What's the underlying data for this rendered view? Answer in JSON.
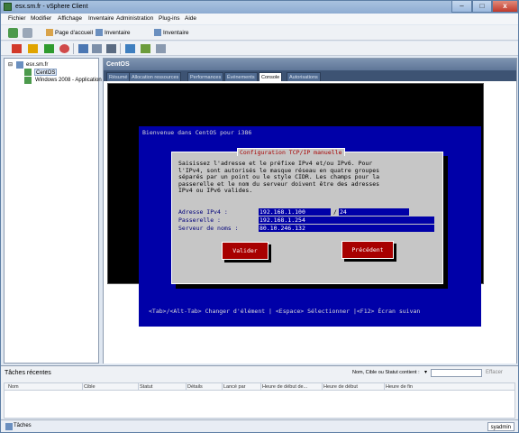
{
  "window": {
    "title": "esx.sm.fr - vSphere Client",
    "controls": [
      "–",
      "□",
      "x"
    ]
  },
  "menu": [
    "Fichier",
    "Modifier",
    "Affichage",
    "Inventaire",
    "Administration",
    "Plug-ins",
    "Aide"
  ],
  "breadcrumb": {
    "home": "Page d'accueil",
    "inventory1": "Inventaire",
    "inventory2": "Inventaire"
  },
  "tree": {
    "host": "esx.sm.fr",
    "vm1": "CentOS",
    "vm2": "Windows 2008 - Application"
  },
  "vm_panel": {
    "title": "CentOS",
    "tabs": [
      "Résumé",
      "Allocation ressources",
      "Performances",
      "Événements",
      "Console",
      "Autorisations"
    ],
    "active_tab": "Console"
  },
  "console": {
    "welcome": "Bienvenue dans CentOS pour i386",
    "dialog_title": "Configuration TCP/IP manuelle",
    "dialog_text": "Saisissez l'adresse et le préfixe IPv4 et/ou IPv6. Pour\nl'IPv4, sont autorisés le masque réseau en quatre groupes\nséparés par un point ou le style CIDR. Les champs pour la\npasserelle et le nom du serveur doivent être des adresses\nIPv4 ou IPv6 valides.",
    "ip_label": "Adresse IPv4 :",
    "ip_value": "192.168.1.100",
    "ip_sep": "/",
    "prefix_value": "24",
    "gateway_label": "Passerelle :",
    "gateway_value": "192.168.1.254",
    "dns_label": "Serveur de noms :",
    "dns_value": "80.10.246.132",
    "ok_button": "Valider",
    "back_button": "Précédent",
    "hint": "<Tab>/<Alt-Tab> Changer d'élément  | <Espace> Sélectionner |<F12> Écran suivan"
  },
  "tasks": {
    "title": "Tâches récentes",
    "filter_label": "Nom, Cible ou Statut contient :",
    "filter_value": "",
    "clear_label": "Effacer",
    "columns": [
      "Nom",
      "Cible",
      "Statut",
      "Détails",
      "Lancé par",
      "Heure de début de...",
      "Heure de début",
      "Heure de fin"
    ]
  },
  "status_bar": {
    "tasks_label": "Tâches",
    "user": "syadmin"
  }
}
